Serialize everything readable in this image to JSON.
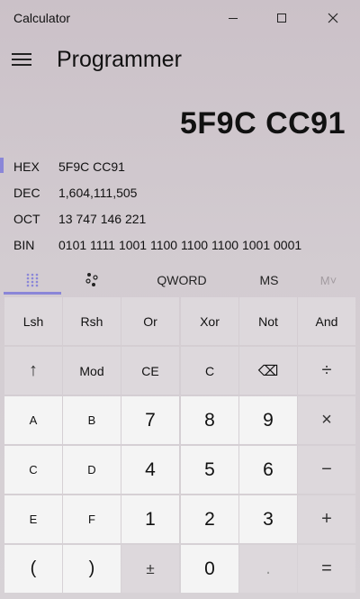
{
  "window": {
    "title": "Calculator"
  },
  "header": {
    "title": "Programmer"
  },
  "display": {
    "value": "5F9C CC91"
  },
  "bases": [
    {
      "label": "HEX",
      "value": "5F9C CC91",
      "active": true
    },
    {
      "label": "DEC",
      "value": "1,604,111,505",
      "active": false
    },
    {
      "label": "OCT",
      "value": "13 747 146 221",
      "active": false
    },
    {
      "label": "BIN",
      "value": "0101 1111 1001 1100 1100 1100 1001 0001",
      "active": false
    }
  ],
  "toolbar": {
    "word_size": "QWORD",
    "memory_store": "MS",
    "memory_dropdown": "M˅"
  },
  "keys": {
    "row1": [
      "Lsh",
      "Rsh",
      "Or",
      "Xor",
      "Not",
      "And"
    ],
    "row2": [
      "↑",
      "Mod",
      "CE",
      "C",
      "⌫",
      "÷"
    ],
    "row3": [
      "A",
      "B",
      "7",
      "8",
      "9",
      "×"
    ],
    "row4": [
      "C",
      "D",
      "4",
      "5",
      "6",
      "−"
    ],
    "row5": [
      "E",
      "F",
      "1",
      "2",
      "3",
      "+"
    ],
    "row6": [
      "(",
      ")",
      "±",
      "0",
      ".",
      "="
    ]
  },
  "accent_color": "#8a86d8"
}
